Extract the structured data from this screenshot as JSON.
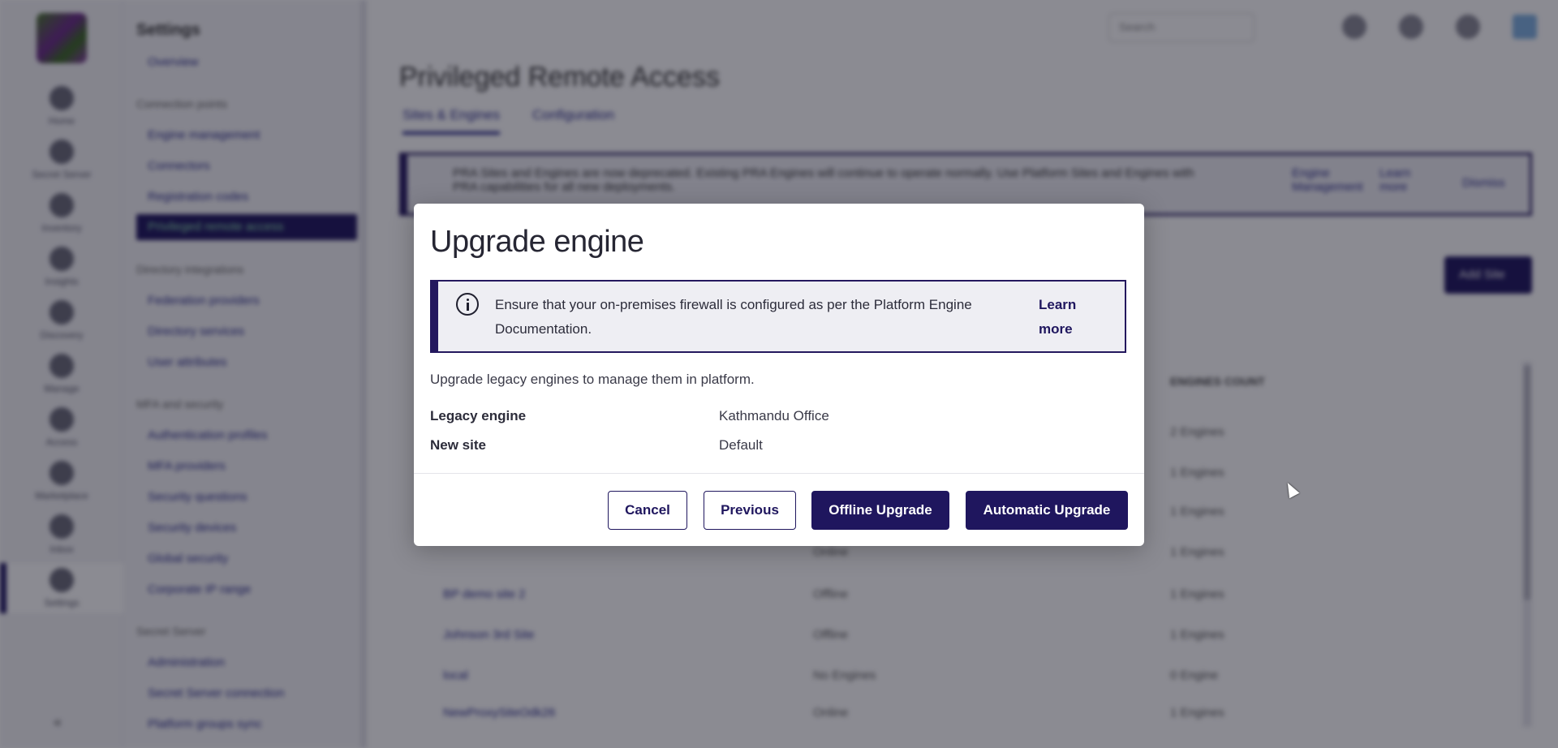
{
  "rail": {
    "items": [
      {
        "label": "Home"
      },
      {
        "label": "Secret Server"
      },
      {
        "label": "Inventory"
      },
      {
        "label": "Insights"
      },
      {
        "label": "Discovery"
      },
      {
        "label": "Manage"
      },
      {
        "label": "Access"
      },
      {
        "label": "Marketplace"
      },
      {
        "label": "Inbox"
      },
      {
        "label": "Settings"
      }
    ],
    "collapse_glyph": "«"
  },
  "subnav": {
    "title": "Settings",
    "overview": "Overview",
    "sections": [
      {
        "title": "Connection points",
        "links": [
          "Engine management",
          "Connectors",
          "Registration codes",
          "Privileged remote access"
        ]
      },
      {
        "title": "Directory integrations",
        "links": [
          "Federation providers",
          "Directory services",
          "User attributes"
        ]
      },
      {
        "title": "MFA and security",
        "links": [
          "Authentication profiles",
          "MFA providers",
          "Security questions",
          "Security devices",
          "Global security",
          "Corporate IP range"
        ]
      },
      {
        "title": "Secret Server",
        "links": [
          "Administration",
          "Secret Server connection",
          "Platform groups sync"
        ]
      }
    ]
  },
  "topbar": {
    "search_placeholder": "Search"
  },
  "page": {
    "title": "Privileged Remote Access",
    "tabs": [
      "Sites & Engines",
      "Configuration"
    ],
    "banner_text": "PRA Sites and Engines are now deprecated. Existing PRA Engines will continue to operate normally. Use Platform Sites and Engines with PRA capabilities for all new deployments.",
    "banner_links": [
      "Engine Management",
      "Learn more",
      "Dismiss"
    ],
    "add_site": "Add Site",
    "table_header_engines": "ENGINES COUNT",
    "rows": [
      {
        "name": "",
        "status": "",
        "engines": "2 Engines"
      },
      {
        "name": "",
        "status": "",
        "engines": "1 Engines"
      },
      {
        "name": "",
        "status": "",
        "engines": "1 Engines"
      },
      {
        "name": "",
        "status": "Online",
        "engines": "1 Engines"
      },
      {
        "name": "BP demo site 2",
        "status": "Offline",
        "engines": "1 Engines"
      },
      {
        "name": "Johnson 3rd Site",
        "status": "Offline",
        "engines": "1 Engines"
      },
      {
        "name": "local",
        "status": "No Engines",
        "engines": "0 Engine"
      },
      {
        "name": "NewProxySiteOdk26",
        "status": "Online",
        "engines": "1 Engines"
      }
    ]
  },
  "modal": {
    "title": "Upgrade engine",
    "alert_text": "Ensure that your on-premises firewall is configured as per the Platform Engine Documentation.",
    "alert_link": "Learn more",
    "description": "Upgrade legacy engines to manage them in platform.",
    "fields": [
      {
        "label": "Legacy engine",
        "value": "Kathmandu Office"
      },
      {
        "label": "New site",
        "value": "Default"
      }
    ],
    "buttons": {
      "cancel": "Cancel",
      "previous": "Previous",
      "offline": "Offline Upgrade",
      "automatic": "Automatic Upgrade"
    },
    "accent_color": "#1f165e"
  }
}
